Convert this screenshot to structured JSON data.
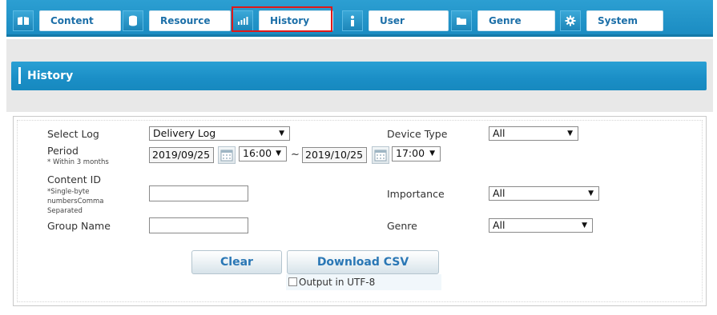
{
  "nav": {
    "tabs": [
      {
        "label": "Content",
        "icon": "book-icon"
      },
      {
        "label": "Resource",
        "icon": "database-icon"
      },
      {
        "label": "History",
        "icon": "bar-chart-icon"
      },
      {
        "label": "User",
        "icon": "user-icon"
      },
      {
        "label": "Genre",
        "icon": "folder-icon"
      },
      {
        "label": "System",
        "icon": "gear-icon"
      }
    ],
    "active": "History"
  },
  "page": {
    "title": "History"
  },
  "form": {
    "select_log": {
      "label": "Select Log",
      "value": "Delivery Log"
    },
    "period": {
      "label": "Period",
      "note": "* Within 3 months",
      "start_date": "2019/09/25",
      "start_time": "16:00",
      "separator": "~",
      "end_date": "2019/10/25",
      "end_time": "17:00"
    },
    "content_id": {
      "label": "Content ID",
      "note_lines": [
        "*Single-byte",
        "numbersComma",
        "Separated"
      ],
      "value": ""
    },
    "group_name": {
      "label": "Group Name",
      "value": ""
    },
    "device_type": {
      "label": "Device Type",
      "value": "All"
    },
    "importance": {
      "label": "Importance",
      "value": "All"
    },
    "genre": {
      "label": "Genre",
      "value": "All"
    }
  },
  "actions": {
    "clear_label": "Clear",
    "download_label": "Download CSV",
    "utf8_label": "Output in UTF-8",
    "utf8_checked": false
  },
  "colors": {
    "nav_blue": "#1b8cc2",
    "title_blue": "#1a8ec6",
    "button_text": "#2a77b5",
    "highlight_red": "#e01818"
  }
}
